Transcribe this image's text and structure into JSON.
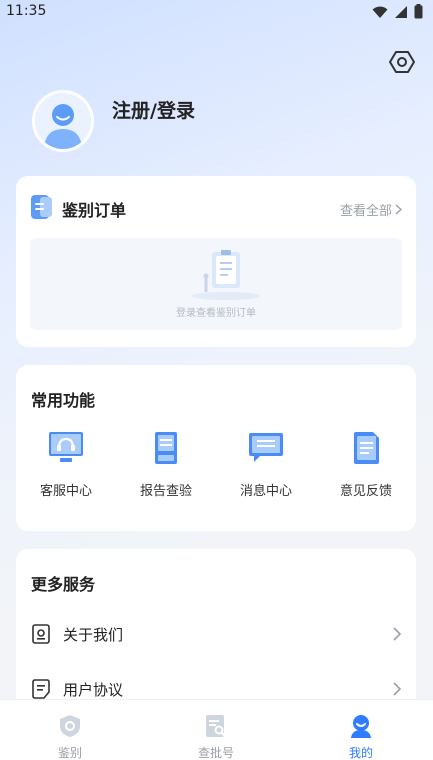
{
  "status_bar": {
    "time": "11:35"
  },
  "profile": {
    "login_label": "注册/登录"
  },
  "orders_card": {
    "title": "鉴别订单",
    "view_all": "查看全部",
    "empty_text": "登录查看鉴别订单"
  },
  "common_functions": {
    "title": "常用功能",
    "items": [
      {
        "label": "客服中心",
        "icon": "headset-icon"
      },
      {
        "label": "报告查验",
        "icon": "report-icon"
      },
      {
        "label": "消息中心",
        "icon": "message-icon"
      },
      {
        "label": "意见反馈",
        "icon": "feedback-icon"
      }
    ]
  },
  "more_services": {
    "title": "更多服务",
    "items": [
      {
        "label": "关于我们",
        "icon": "about-icon"
      },
      {
        "label": "用户协议",
        "icon": "agreement-icon"
      }
    ]
  },
  "tabbar": {
    "items": [
      {
        "label": "鉴别",
        "icon": "shield-icon",
        "active": false
      },
      {
        "label": "查批号",
        "icon": "batch-search-icon",
        "active": false
      },
      {
        "label": "我的",
        "icon": "profile-icon",
        "active": true
      }
    ]
  },
  "colors": {
    "accent": "#2f7cff",
    "icon_blue": "#4a8cf5"
  }
}
